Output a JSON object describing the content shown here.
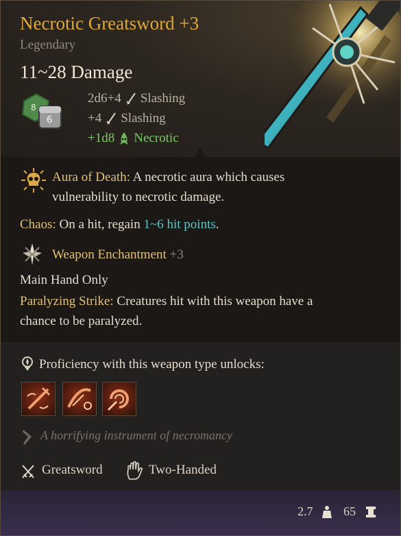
{
  "item": {
    "name": "Necrotic Greatsword +3",
    "rarity": "Legendary",
    "damage_total": "11~28 Damage"
  },
  "damage_lines": [
    {
      "amount": "2d6+4",
      "type": "Slashing",
      "icon": "slash-icon"
    },
    {
      "amount": "+4",
      "type": "Slashing",
      "icon": "slash-icon"
    },
    {
      "amount": "+1d8",
      "type": "Necrotic",
      "icon": "necrotic-icon"
    }
  ],
  "properties": {
    "aura_title": "Aura of Death:",
    "aura_text_1": "A necrotic aura which causes",
    "aura_text_2": "vulnerability to necrotic damage.",
    "chaos_title": "Chaos:",
    "chaos_text_a": "On a hit, regain",
    "chaos_highlight": "1~6 hit points",
    "chaos_text_b": ".",
    "enchant_label": "Weapon Enchantment",
    "enchant_value": "+3",
    "main_hand": "Main Hand Only",
    "paralyze_title": "Paralyzing Strike:",
    "paralyze_text_1": "Creatures hit with this weapon have a",
    "paralyze_text_2": "chance to be paralyzed."
  },
  "proficiency": {
    "label": "Proficiency with this weapon type unlocks:"
  },
  "flavor": "A horrifying instrument of necromancy",
  "tags": {
    "weapon_type": "Greatsword",
    "handedness": "Two-Handed"
  },
  "stats": {
    "weight": "2.7",
    "value": "65"
  },
  "colors": {
    "title": "#e0a93a",
    "necrotic": "#7ec967",
    "highlight": "#5ec4c8"
  }
}
